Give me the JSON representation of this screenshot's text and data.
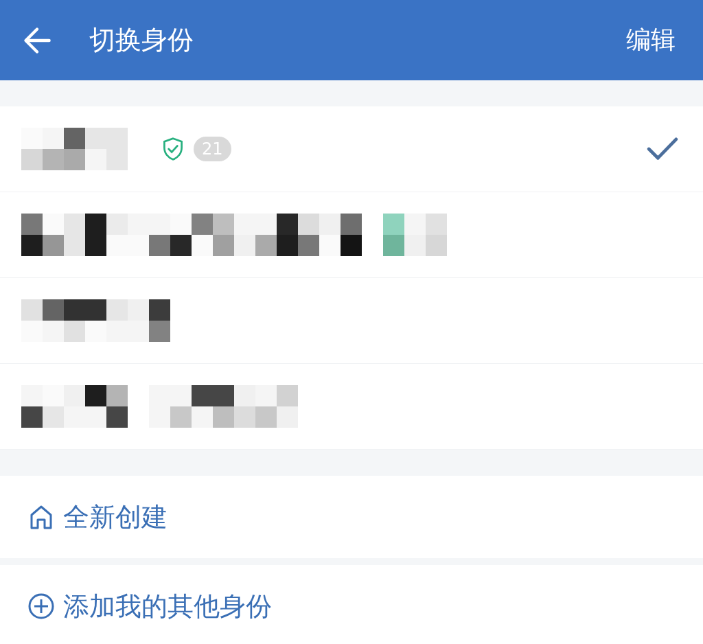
{
  "header": {
    "title": "切换身份",
    "action": "编辑"
  },
  "identities": [
    {
      "selected": true,
      "verified": true,
      "count": "21"
    },
    {
      "selected": false,
      "verified": false
    },
    {
      "selected": false,
      "verified": false
    },
    {
      "selected": false,
      "verified": false
    }
  ],
  "actions": [
    {
      "kind": "create",
      "label": "全新创建"
    },
    {
      "kind": "add",
      "label": "添加我的其他身份"
    }
  ]
}
